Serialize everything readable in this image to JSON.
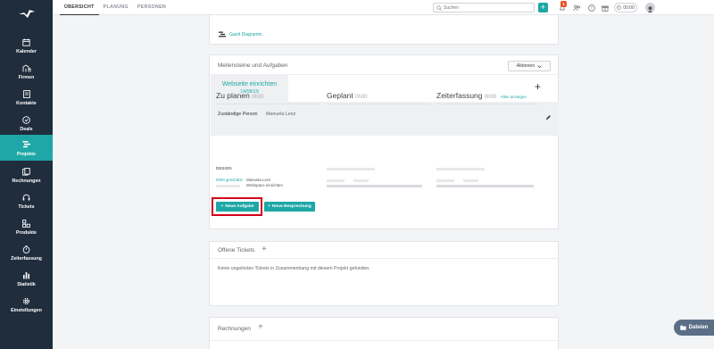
{
  "sidebar": {
    "logo_icon": "bird-logo-icon",
    "items": [
      {
        "label": "Kalender",
        "icon": "calendar-icon"
      },
      {
        "label": "Firmen",
        "icon": "buildings-icon"
      },
      {
        "label": "Kontakte",
        "icon": "contact-card-icon"
      },
      {
        "label": "Deals",
        "icon": "target-icon"
      },
      {
        "label": "Projekte",
        "icon": "projects-icon",
        "active": true
      },
      {
        "label": "Rechnungen",
        "icon": "invoice-icon"
      },
      {
        "label": "Tickets",
        "icon": "headset-icon"
      },
      {
        "label": "Produkte",
        "icon": "products-icon"
      },
      {
        "label": "Zeiterfassung",
        "icon": "stopwatch-icon"
      },
      {
        "label": "Statistik",
        "icon": "bar-chart-icon"
      },
      {
        "label": "Einstellungen",
        "icon": "gear-icon"
      }
    ]
  },
  "topbar": {
    "tabs": [
      {
        "label": "ÜBERSICHT",
        "active": true
      },
      {
        "label": "PLANUNG",
        "active": false
      },
      {
        "label": "PERSONEN",
        "active": false
      }
    ],
    "search_placeholder": "Suchen",
    "plus_label": "+",
    "notification_count": "1",
    "timer": "00:00"
  },
  "gantt": {
    "link_label": "Gantt Diagramm"
  },
  "milestones": {
    "title": "Meilensteine und Aufgaben",
    "actions_label": "Aktionen",
    "milestone": {
      "name": "Webseite einrichten",
      "date": "14/08/19"
    },
    "plus_label": "+",
    "responsible_label": "Zuständige Person",
    "responsible_value": "Manuela Lenz",
    "columns": [
      {
        "title": "Zu planen",
        "time": "0h00",
        "link": ""
      },
      {
        "title": "Geplant",
        "time": "0h00",
        "link": ""
      },
      {
        "title": "Zeiterfassung",
        "time": "0h00",
        "link": "Alles anzeigen"
      }
    ],
    "group_label": "DESIGN",
    "task": {
      "estimate": "0h00 geschätzt",
      "person": "Manuela Lenz",
      "name": "Webspace einrichten"
    },
    "new_task_label": "Neue Aufgabe",
    "new_meeting_label": "Neue Besprechung"
  },
  "tickets": {
    "title": "Offene Tickets",
    "plus_label": "+",
    "empty_text": "Keine ungelösten Tickets in Zusammenhang mit diesem Projekt gefunden."
  },
  "invoices": {
    "title": "Rechnungen",
    "plus_label": "+"
  },
  "files_button": {
    "label": "Dateien"
  },
  "colors": {
    "accent": "#1ea7a6",
    "sidebar": "#1f2d3d",
    "highlight": "#d0021b"
  }
}
